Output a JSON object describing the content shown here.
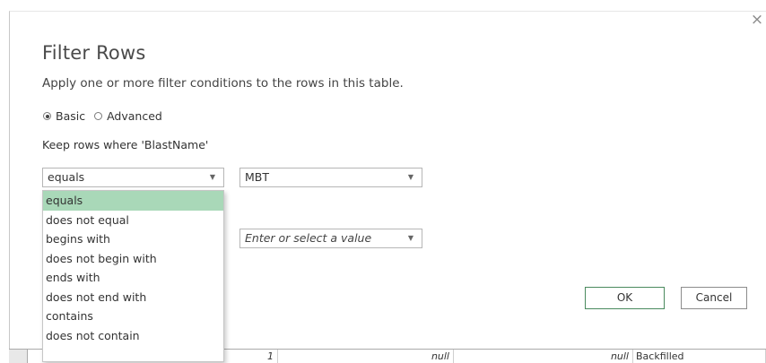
{
  "dialog": {
    "title": "Filter Rows",
    "subtitle": "Apply one or more filter conditions to the rows in this table.",
    "close_glyph": "×",
    "mode": {
      "basic_label": "Basic",
      "advanced_label": "Advanced",
      "selected": "Basic"
    },
    "keep_label": "Keep rows where 'BlastName'",
    "condition1": {
      "operator": "equals",
      "value": "MBT"
    },
    "condition2": {
      "operator": "",
      "value_placeholder": "Enter or select a value"
    },
    "operator_options": [
      "equals",
      "does not equal",
      "begins with",
      "does not begin with",
      "ends with",
      "does not end with",
      "contains",
      "does not contain"
    ],
    "selected_option": "equals",
    "ok_label": "OK",
    "cancel_label": "Cancel"
  },
  "background_row": {
    "cells": [
      "1",
      "null",
      "null",
      "Backfilled"
    ]
  },
  "colors": {
    "selected_option": "#a9d8b8",
    "ok_border": "#4a8a5e"
  }
}
